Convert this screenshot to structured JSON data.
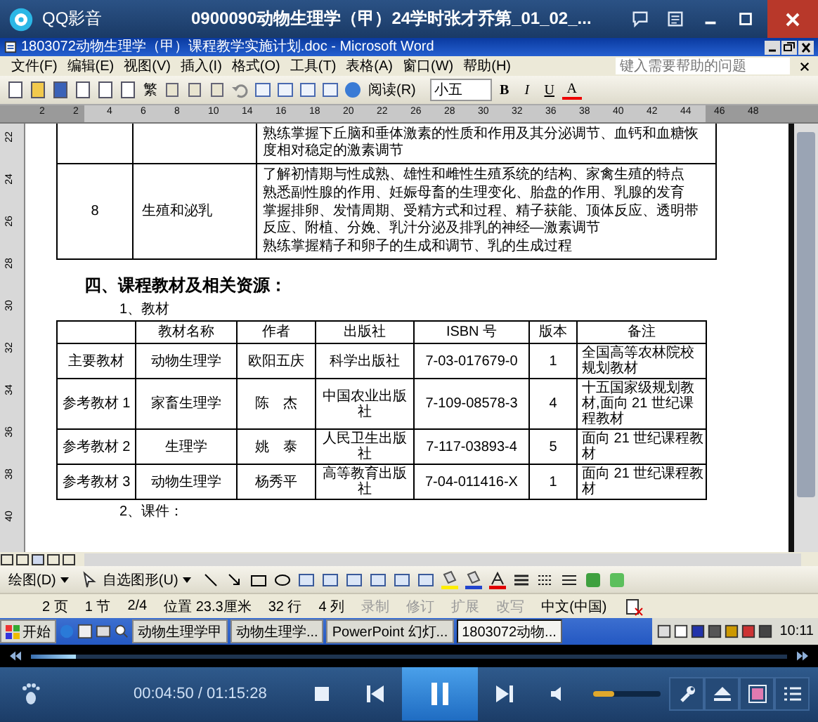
{
  "player": {
    "app_name": "QQ影音",
    "title": "0900090动物生理学（甲）24学时张才乔第_01_02_..."
  },
  "word": {
    "title": "1803072动物生理学（甲）课程教学实施计划.doc - Microsoft Word",
    "menu": [
      "文件(F)",
      "编辑(E)",
      "视图(V)",
      "插入(I)",
      "格式(O)",
      "工具(T)",
      "表格(A)",
      "窗口(W)",
      "帮助(H)"
    ],
    "help_search": {
      "placeholder": "键入需要帮助的问题"
    },
    "toolbar": {
      "traditional_button": "繁",
      "read_button": "阅读(R)",
      "font_size": "小五",
      "bold": "B",
      "italic": "I",
      "underline": "U",
      "font_color": "A"
    },
    "ruler_numbers": [
      "2",
      "2",
      "4",
      "6",
      "8",
      "10",
      "14",
      "16",
      "18",
      "20",
      "22",
      "26",
      "28",
      "30",
      "32",
      "36",
      "38",
      "40",
      "42",
      "44",
      "46",
      "48"
    ],
    "vertical_ruler_numbers": [
      "22",
      "24",
      "26",
      "28",
      "30",
      "32",
      "34",
      "36",
      "38",
      "40"
    ],
    "outline_table": {
      "rows": [
        {
          "number": "",
          "topic": "",
          "lines": [
            "熟练掌握下丘脑和垂体激素的性质和作用及其分泌调节、血钙和血糖恢度相对稳定的激素调节"
          ]
        },
        {
          "number": "8",
          "topic": "生殖和泌乳",
          "lines": [
            "了解初情期与性成熟、雄性和雌性生殖系统的结构、家禽生殖的特点",
            "熟悉副性腺的作用、妊娠母畜的生理变化、胎盘的作用、乳腺的发育",
            "掌握排卵、发情周期、受精方式和过程、精子获能、顶体反应、透明带反应、附植、分娩、乳汁分泌及排乳的神经—激素调节",
            "熟练掌握精子和卵子的生成和调节、乳的生成过程"
          ]
        }
      ]
    },
    "heading": "四、课程教材及相关资源：",
    "subheading_1": "1、教材",
    "books_table": {
      "columns": [
        "",
        "教材名称",
        "作者",
        "出版社",
        "ISBN 号",
        "版本",
        "备注"
      ],
      "rows": [
        [
          "主要教材",
          "动物生理学",
          "欧阳五庆",
          "科学出版社",
          "7-03-017679-0",
          "1",
          "全国高等农林院校规划教材"
        ],
        [
          "参考教材 1",
          "家畜生理学",
          "陈　杰",
          "中国农业出版社",
          "7-109-08578-3",
          "4",
          "十五国家级规划教材,面向 21 世纪课程教材"
        ],
        [
          "参考教材 2",
          "生理学",
          "姚　泰",
          "人民卫生出版社",
          "7-117-03893-4",
          "5",
          "面向 21 世纪课程教材"
        ],
        [
          "参考教材 3",
          "动物生理学",
          "杨秀平",
          "高等教育出版社",
          "7-04-011416-X",
          "1",
          "面向 21 世纪课程教材"
        ]
      ]
    },
    "subheading_2": "2、课件：",
    "drawing_toolbar": {
      "draw_menu": "绘图(D)",
      "autoshapes_menu": "自选图形(U)"
    },
    "status_bar": [
      {
        "text": "2 页",
        "disabled": false
      },
      {
        "text": "1 节",
        "disabled": false
      },
      {
        "text": "2/4",
        "disabled": false
      },
      {
        "text": "位置 23.3厘米",
        "disabled": false
      },
      {
        "text": "32 行",
        "disabled": false
      },
      {
        "text": "4 列",
        "disabled": false
      },
      {
        "text": "录制",
        "disabled": true
      },
      {
        "text": "修订",
        "disabled": true
      },
      {
        "text": "扩展",
        "disabled": true
      },
      {
        "text": "改写",
        "disabled": true
      },
      {
        "text": "中文(中国)",
        "disabled": false
      }
    ]
  },
  "taskbar": {
    "start": "开始",
    "tasks": [
      {
        "label": "动物生理学甲",
        "selected": false
      },
      {
        "label": "动物生理学...",
        "selected": false
      },
      {
        "label": "PowerPoint 幻灯...",
        "selected": false
      },
      {
        "label": "1803072动物...",
        "selected": true
      }
    ],
    "clock": "10:11"
  },
  "playback": {
    "progress": {
      "level": 0.06
    },
    "time": "00:04:50 / 01:15:28",
    "volume": {
      "level": 0.32
    }
  }
}
